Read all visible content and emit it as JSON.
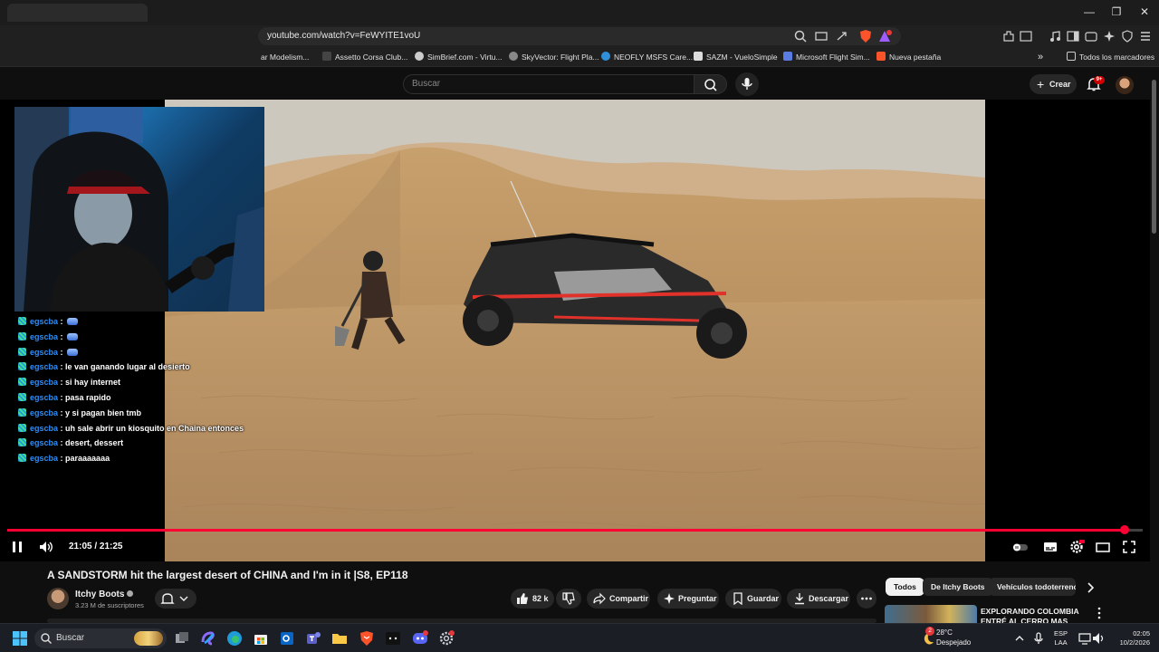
{
  "browser": {
    "url": "youtube.com/watch?v=FeWYITE1voU",
    "bookmarks": [
      "ar Modelism...",
      "Assetto Corsa Club...",
      "SimBrief.com - Virtu...",
      "SkyVector: Flight Pla...",
      "NEOFLY MSFS Care...",
      "SAZM - VueloSimple",
      "Microsoft Flight Sim...",
      "Nueva pestaña"
    ],
    "all_bookmarks_label": "Todos los marcadores",
    "window_controls": [
      "—",
      "❐",
      "✕"
    ]
  },
  "youtube": {
    "search_placeholder": "Buscar",
    "create_label": "Crear",
    "notifications_badge": "9+"
  },
  "chat": [
    {
      "user": "egscba",
      "sep": " : ",
      "message": "",
      "emote": true
    },
    {
      "user": "egscba",
      "sep": " : ",
      "message": "",
      "emote": true
    },
    {
      "user": "egscba",
      "sep": " : ",
      "message": "",
      "emote": true
    },
    {
      "user": "egscba",
      "sep": " : ",
      "message": "le van ganando lugar al desierto",
      "emote": false
    },
    {
      "user": "egscba",
      "sep": " : ",
      "message": "si hay internet",
      "emote": false
    },
    {
      "user": "egscba",
      "sep": " : ",
      "message": "pasa rapido",
      "emote": false
    },
    {
      "user": "egscba",
      "sep": " : ",
      "message": "y si pagan bien tmb",
      "emote": false
    },
    {
      "user": "egscba",
      "sep": " : ",
      "message": "uh sale abrir un kiosquito en Chaina entonces",
      "emote": false
    },
    {
      "user": "egscba",
      "sep": " : ",
      "message": "desert, dessert",
      "emote": false
    },
    {
      "user": "egscba",
      "sep": " : ",
      "message": "paraaaaaaa",
      "emote": false
    }
  ],
  "player": {
    "time": "21:05 / 21:25",
    "progress": 0.9844
  },
  "video": {
    "title": "A SANDSTORM hit the largest desert of CHINA and I'm in it |S8, EP118",
    "channel": "Itchy Boots",
    "subscribers": "3.23 M de suscriptores",
    "likes": "82 k",
    "share_label": "Compartir",
    "ask_label": "Preguntar",
    "save_label": "Guardar",
    "download_label": "Descargar"
  },
  "sidebar": {
    "chips": [
      "Todos",
      "De Itchy Boots",
      "Vehículos todoterreno"
    ],
    "rec_title": "EXPLORANDO COLOMBIA ENTRÉ AL CERRO MAS TRIST"
  },
  "taskbar": {
    "search_placeholder": "Buscar",
    "weather_temp": "28°C",
    "weather_desc": "Despejado",
    "lang": "ESP",
    "lang_sub": "LAA",
    "time": "02:05",
    "date": "10/2/2026",
    "weather_badge": "2"
  },
  "colors": {
    "youtube_red": "#ff0033",
    "chat_username": "#2e8df6",
    "brave_orange": "#fb542b"
  }
}
